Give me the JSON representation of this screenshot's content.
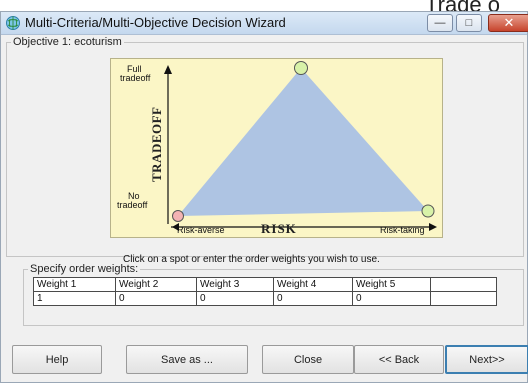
{
  "overlay": {
    "cropped_text": "Trade o"
  },
  "window": {
    "title": "Multi-Criteria/Multi-Objective Decision Wizard",
    "controls": {
      "minimize_glyph": "—",
      "maximize_glyph": "□",
      "close_glyph": "✕"
    }
  },
  "objective": {
    "legend": "Objective 1: ecoturism"
  },
  "diagram": {
    "y_top_label_1": "Full",
    "y_top_label_2": "tradeoff",
    "y_bottom_label_1": "No",
    "y_bottom_label_2": "tradeoff",
    "y_axis_title": "TRADEOFF",
    "x_axis_title": "RISK",
    "x_left_label": "Risk-averse",
    "x_right_label": "Risk-taking",
    "colors": {
      "background": "#fbf6c6",
      "triangle": "#aec4e3",
      "left_dot": "#f3b3b3",
      "apex_dot": "#d8f2a8",
      "right_dot": "#d8f2a8"
    }
  },
  "instruction": "Click on a spot or enter the order weights you wish to use.",
  "weights": {
    "legend": "Specify order weights:",
    "headers": [
      "Weight 1",
      "Weight 2",
      "Weight 3",
      "Weight 4",
      "Weight 5",
      ""
    ],
    "values": [
      "1",
      "0",
      "0",
      "0",
      "0",
      ""
    ]
  },
  "buttons": {
    "help": "Help",
    "save_as": "Save as ...",
    "close": "Close",
    "back": "<< Back",
    "next": "Next>>"
  }
}
